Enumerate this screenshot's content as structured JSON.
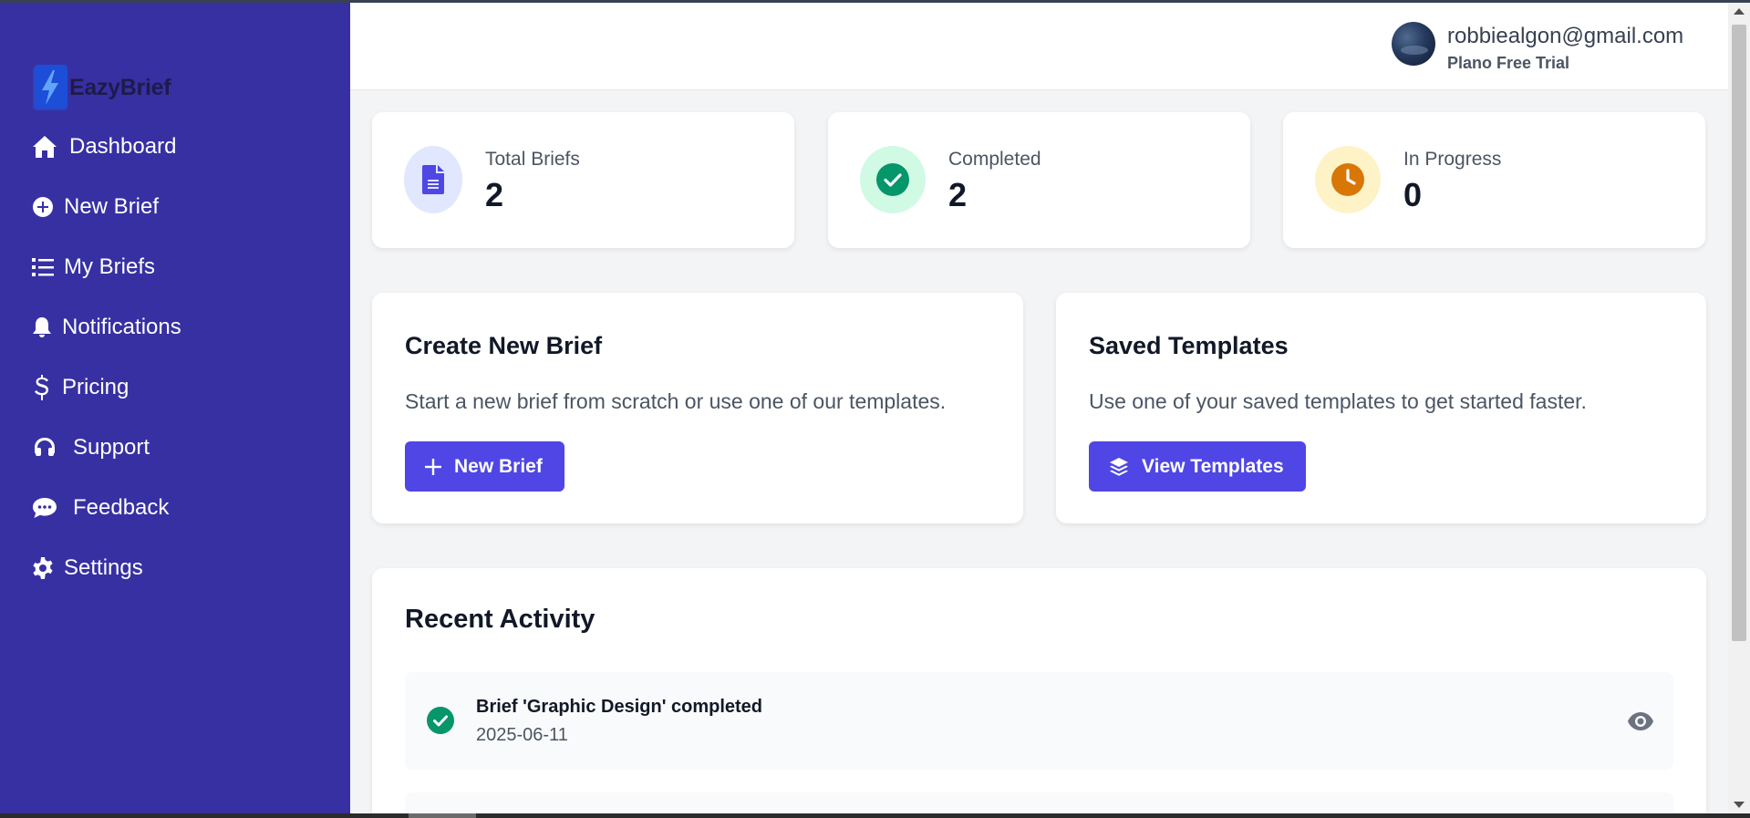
{
  "brand": {
    "name": "EazyBrief",
    "accent": "#4f46e5",
    "sidebar_bg": "#3730a3"
  },
  "sidebar": {
    "items": [
      {
        "label": "Dashboard",
        "icon": "home-icon"
      },
      {
        "label": "New Brief",
        "icon": "plus-circle-icon"
      },
      {
        "label": "My Briefs",
        "icon": "list-icon"
      },
      {
        "label": "Notifications",
        "icon": "bell-icon"
      },
      {
        "label": "Pricing",
        "icon": "dollar-icon"
      },
      {
        "label": "Support",
        "icon": "headset-icon"
      },
      {
        "label": "Feedback",
        "icon": "comment-icon"
      },
      {
        "label": "Settings",
        "icon": "gear-icon"
      }
    ]
  },
  "header": {
    "user_email": "robbiealgon@gmail.com",
    "user_plan": "Plano Free Trial"
  },
  "stats": [
    {
      "label": "Total Briefs",
      "value": "2",
      "icon": "document-icon",
      "color": "#4f46e5",
      "bg": "#e0e7ff"
    },
    {
      "label": "Completed",
      "value": "2",
      "icon": "check-circle-icon",
      "color": "#059669",
      "bg": "#d1fae5"
    },
    {
      "label": "In Progress",
      "value": "0",
      "icon": "clock-icon",
      "color": "#d97706",
      "bg": "#fef3c7"
    }
  ],
  "create_card": {
    "title": "Create New Brief",
    "description": "Start a new brief from scratch or use one of our templates.",
    "button_label": "New Brief"
  },
  "templates_card": {
    "title": "Saved Templates",
    "description": "Use one of your saved templates to get started faster.",
    "button_label": "View Templates"
  },
  "recent_activity": {
    "title": "Recent Activity",
    "items": [
      {
        "text": "Brief 'Graphic Design' completed",
        "date": "2025-06-11",
        "icon": "check-circle-icon"
      }
    ]
  }
}
